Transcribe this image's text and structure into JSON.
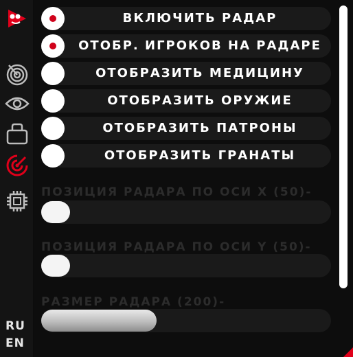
{
  "toggles": [
    {
      "label": "включить радар",
      "checked": true
    },
    {
      "label": "отобр. игроков на радаре",
      "checked": true
    },
    {
      "label": "отобразить медицину",
      "checked": false
    },
    {
      "label": "отобразить оружие",
      "checked": false
    },
    {
      "label": "отобразить патроны",
      "checked": false
    },
    {
      "label": "отобразить гранаты",
      "checked": false
    }
  ],
  "sliders": [
    {
      "label": "позиция радара по оси x (50)-",
      "value": 50
    },
    {
      "label": "позиция радара по оси y (50)-",
      "value": 50
    },
    {
      "label": "размер радара (200)-",
      "value": 200
    }
  ],
  "languages": [
    "RU",
    "EN"
  ],
  "sidebar_icons": [
    "logo-icon",
    "radar-icon",
    "eye-icon",
    "bag-icon",
    "target-icon",
    "chip-icon"
  ],
  "colors": {
    "accent": "#d0021b",
    "background": "#0d0d0d",
    "sidebar": "#141414",
    "row": "#1a1a1a"
  }
}
